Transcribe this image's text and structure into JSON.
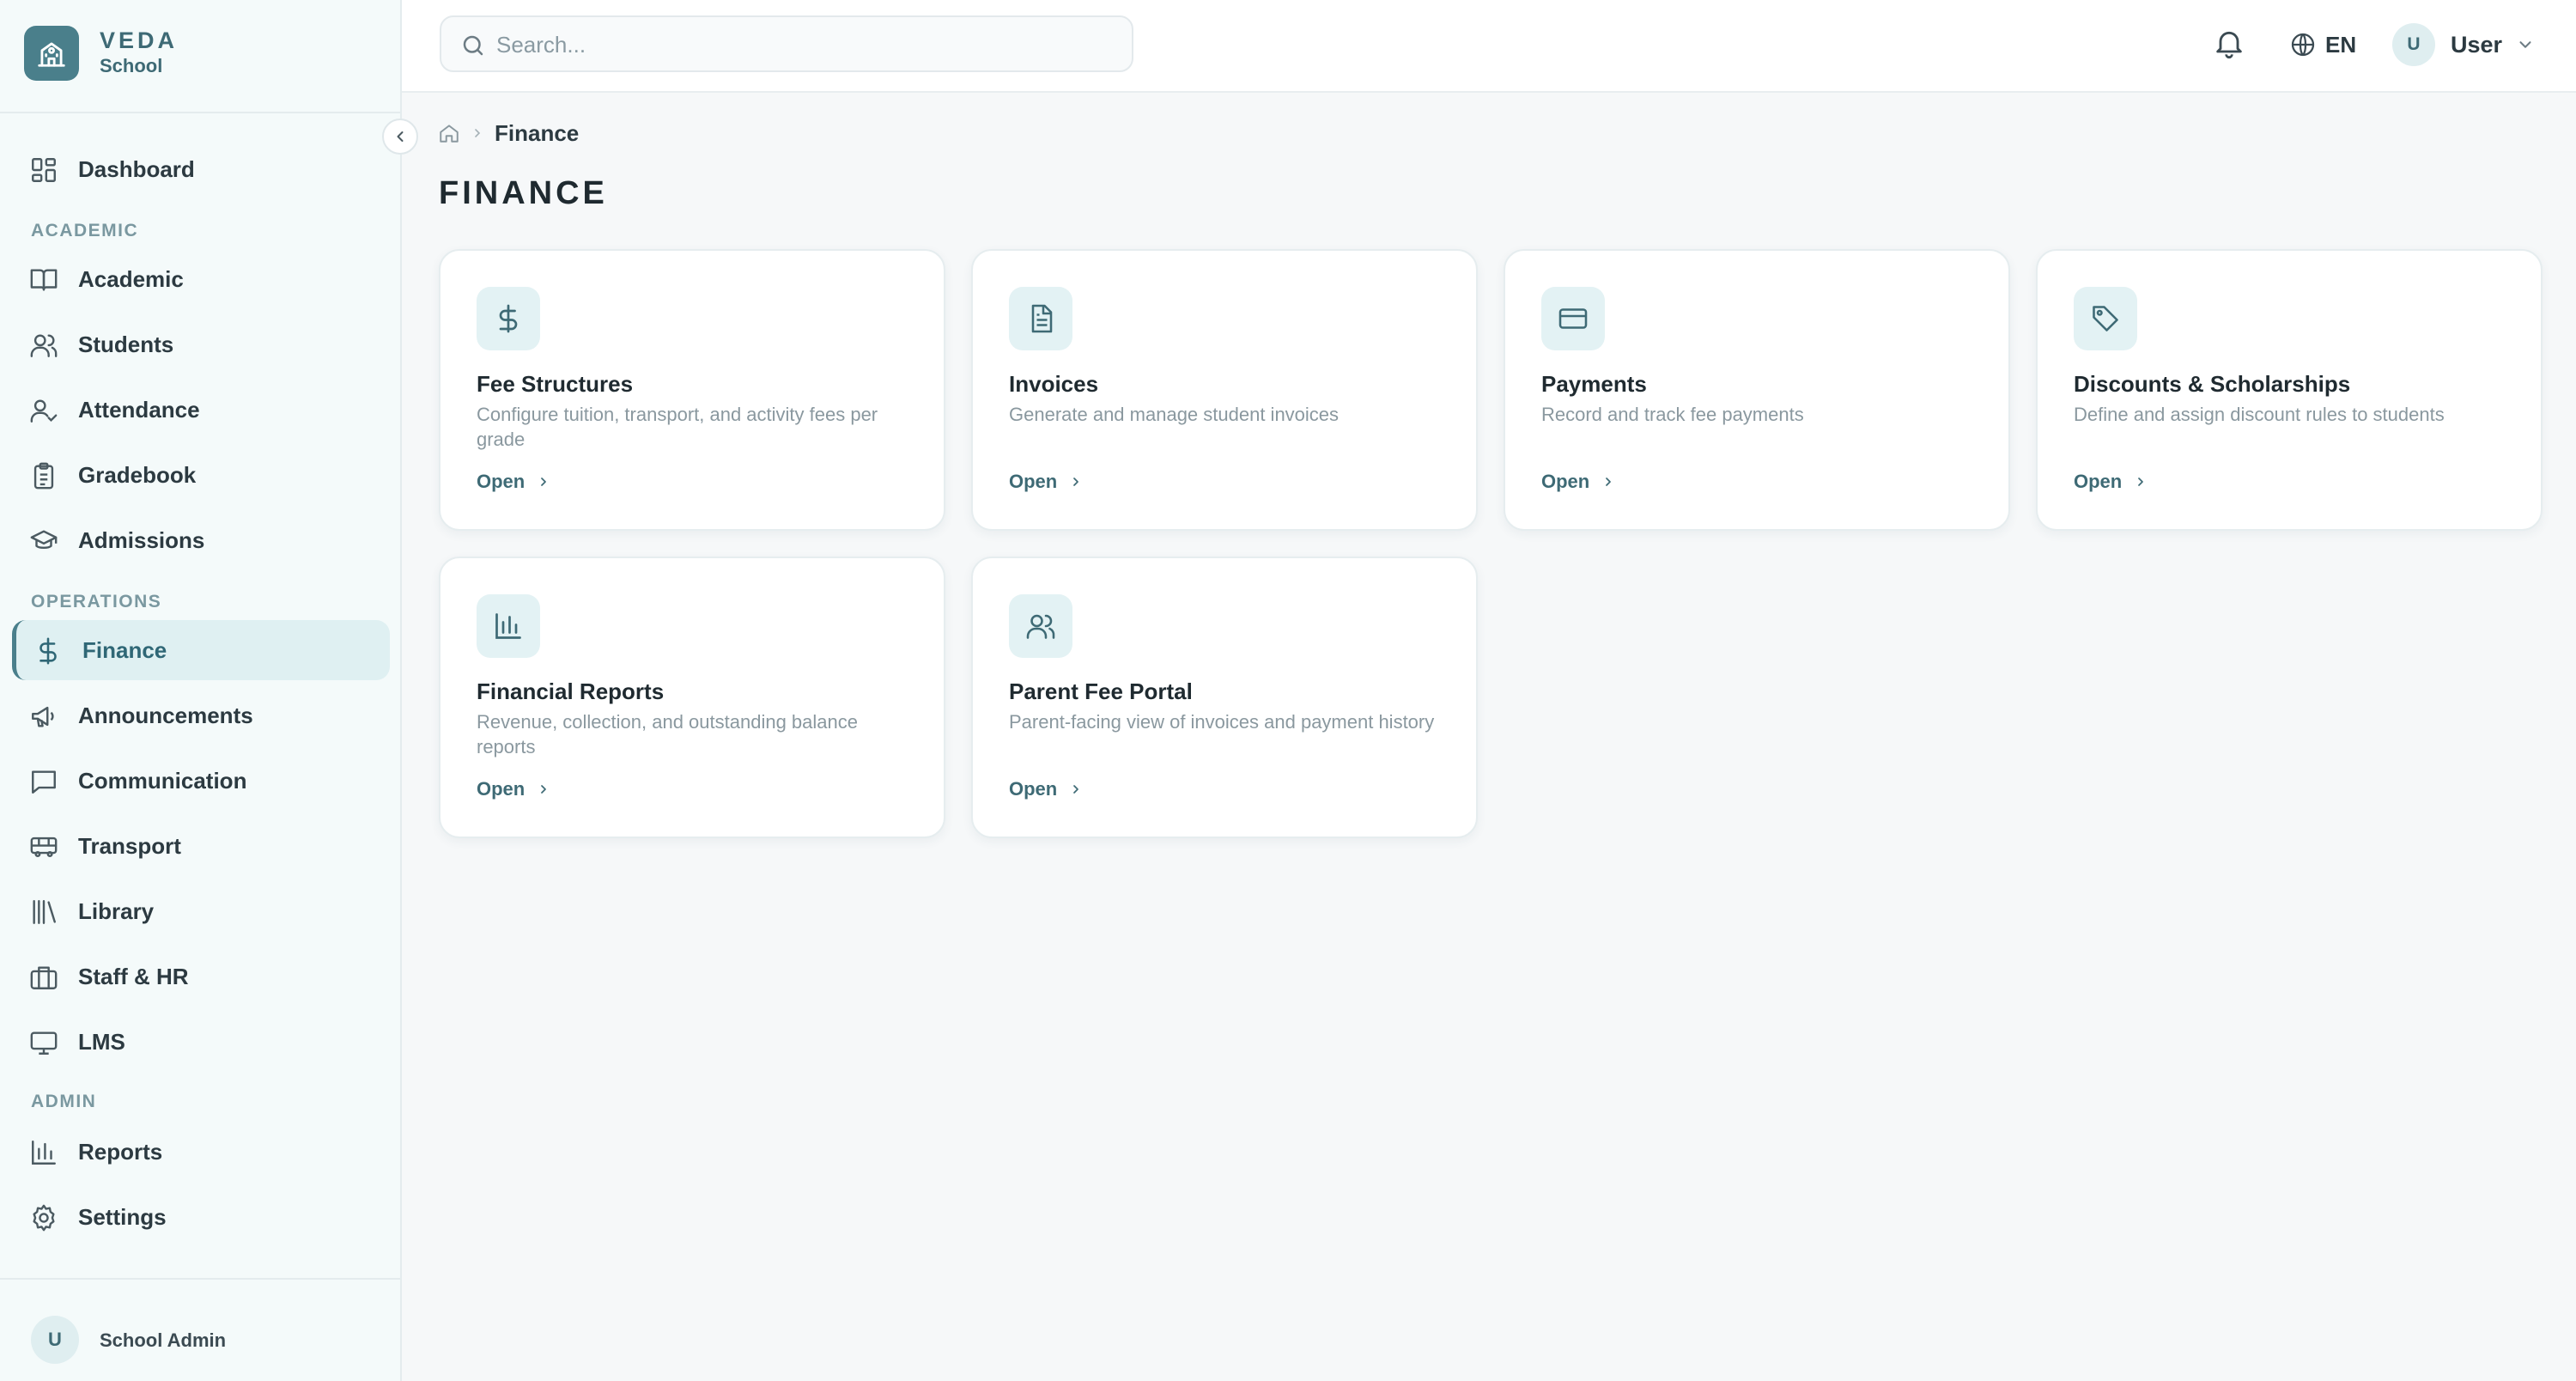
{
  "brand": {
    "name": "VEDA",
    "sub": "School"
  },
  "header": {
    "search_placeholder": "Search...",
    "language": "EN",
    "user_initial": "U",
    "user_name": "User"
  },
  "sidebar": {
    "sections": {
      "academic": "ACADEMIC",
      "operations": "OPERATIONS",
      "admin": "ADMIN"
    },
    "items": [
      {
        "label": "Dashboard",
        "icon": "dashboard-icon"
      },
      {
        "label": "Academic",
        "icon": "book-icon"
      },
      {
        "label": "Students",
        "icon": "users-icon"
      },
      {
        "label": "Attendance",
        "icon": "user-check-icon"
      },
      {
        "label": "Gradebook",
        "icon": "clipboard-icon"
      },
      {
        "label": "Admissions",
        "icon": "graduation-cap-icon"
      },
      {
        "label": "Finance",
        "icon": "dollar-icon",
        "active": true
      },
      {
        "label": "Announcements",
        "icon": "megaphone-icon"
      },
      {
        "label": "Communication",
        "icon": "message-icon"
      },
      {
        "label": "Transport",
        "icon": "bus-icon"
      },
      {
        "label": "Library",
        "icon": "library-icon"
      },
      {
        "label": "Staff & HR",
        "icon": "briefcase-icon"
      },
      {
        "label": "LMS",
        "icon": "monitor-icon"
      },
      {
        "label": "Reports",
        "icon": "bar-chart-icon"
      },
      {
        "label": "Settings",
        "icon": "gear-icon"
      }
    ],
    "footer": {
      "initial": "U",
      "name": "School Admin"
    }
  },
  "breadcrumb": {
    "current": "Finance"
  },
  "page": {
    "title": "FINANCE"
  },
  "cards": [
    {
      "title": "Fee Structures",
      "desc": "Configure tuition, transport, and activity fees per grade",
      "action": "Open",
      "icon": "dollar-icon"
    },
    {
      "title": "Invoices",
      "desc": "Generate and manage student invoices",
      "action": "Open",
      "icon": "file-text-icon"
    },
    {
      "title": "Payments",
      "desc": "Record and track fee payments",
      "action": "Open",
      "icon": "credit-card-icon"
    },
    {
      "title": "Discounts & Scholarships",
      "desc": "Define and assign discount rules to students",
      "action": "Open",
      "icon": "tag-icon"
    },
    {
      "title": "Financial Reports",
      "desc": "Revenue, collection, and outstanding balance reports",
      "action": "Open",
      "icon": "bar-chart-icon"
    },
    {
      "title": "Parent Fee Portal",
      "desc": "Parent-facing view of invoices and payment history",
      "action": "Open",
      "icon": "users-icon"
    }
  ],
  "colors": {
    "accent": "#4a7f8b",
    "accent_light": "#dff0f2",
    "text": "#1f2a30",
    "muted": "#8a989f"
  }
}
